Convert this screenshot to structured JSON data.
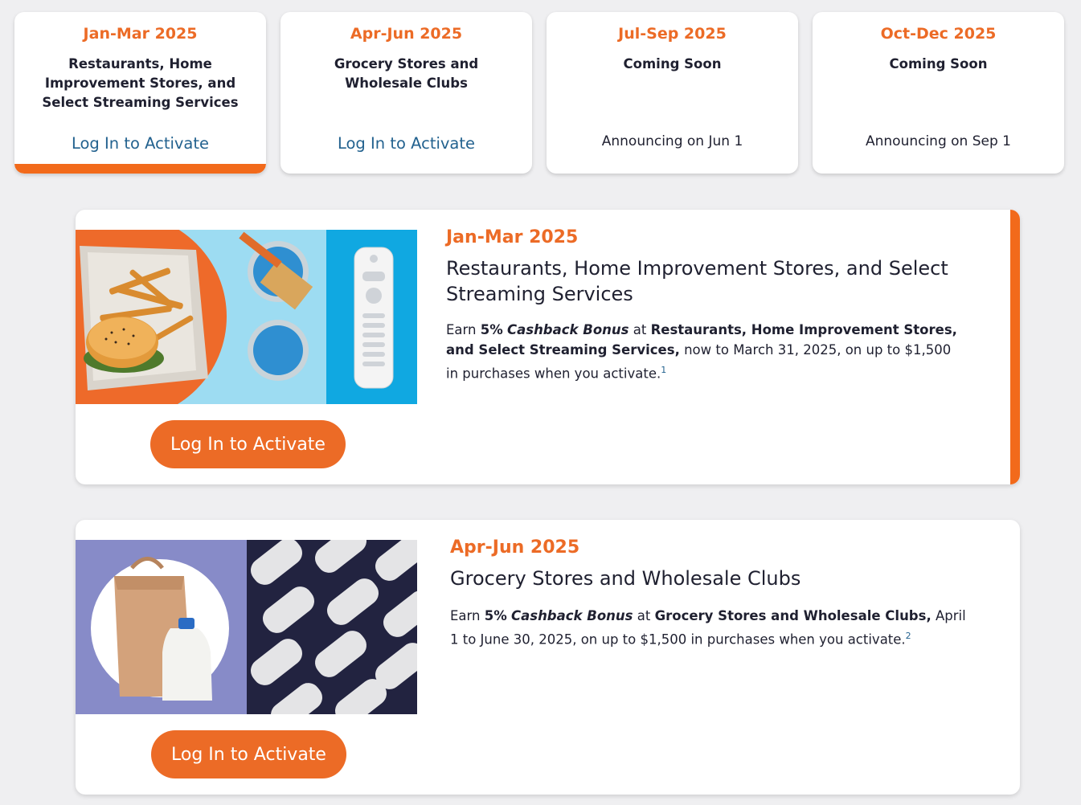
{
  "tabs": [
    {
      "quarter": "Jan-Mar 2025",
      "title": "Restaurants, Home Improvement Stores, and Select Streaming Services",
      "action": "Log In to Activate"
    },
    {
      "quarter": "Apr-Jun 2025",
      "title": "Grocery Stores and Wholesale Clubs",
      "action": "Log In to Activate"
    },
    {
      "quarter": "Jul-Sep 2025",
      "title": "Coming Soon",
      "announce": "Announcing on Jun 1"
    },
    {
      "quarter": "Oct-Dec 2025",
      "title": "Coming Soon",
      "announce": "Announcing on Sep 1"
    }
  ],
  "offers": [
    {
      "quarter": "Jan-Mar 2025",
      "heading": "Restaurants, Home Improvement Stores, and Select Streaming Services",
      "desc_1": "Earn ",
      "desc_pct": "5%",
      "desc_bonus": "Cashback Bonus",
      "desc_2": " at ",
      "desc_cat": "Restaurants, Home Improvement Stores, and Select Streaming Services,",
      "desc_3": " now to March 31, 2025, on up to $1,500 in purchases when you activate.",
      "footnote": "1",
      "button": "Log In to Activate"
    },
    {
      "quarter": "Apr-Jun 2025",
      "heading": "Grocery Stores and Wholesale Clubs",
      "desc_1": "Earn ",
      "desc_pct": "5%",
      "desc_bonus": "Cashback Bonus",
      "desc_2": " at ",
      "desc_cat": "Grocery Stores and Wholesale Clubs,",
      "desc_3": " April 1 to June 30, 2025, on up to $1,500 in purchases when you activate.",
      "footnote": "2",
      "button": "Log In to Activate"
    }
  ],
  "colors": {
    "accent": "#ec6b26",
    "link": "#23628f",
    "background": "#efeff1"
  }
}
